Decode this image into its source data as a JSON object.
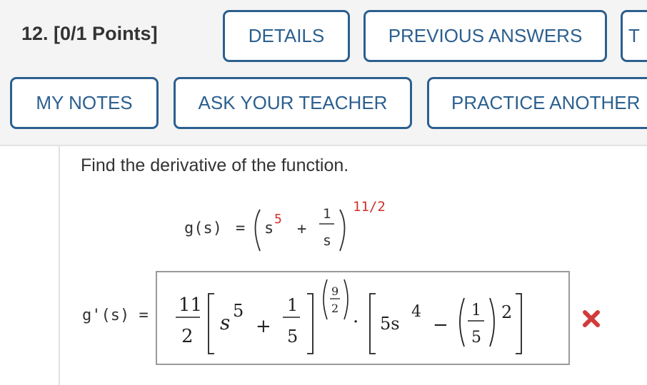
{
  "question": {
    "number_label": "12. [0/1 Points]"
  },
  "toolbar": {
    "details_label": "DETAILS",
    "previous_answers_label": "PREVIOUS ANSWERS",
    "overflow_label": "T",
    "my_notes_label": "MY NOTES",
    "ask_teacher_label": "ASK YOUR TEACHER",
    "practice_another_label": "PRACTICE ANOTHER"
  },
  "problem": {
    "prompt": "Find the derivative of the function.",
    "function_name": "g(s)",
    "equals": "=",
    "base_var": "s",
    "base_exp": "5",
    "plus": "+",
    "frac_num": "1",
    "frac_den": "s",
    "outer_exp": "11/2"
  },
  "answer": {
    "label": "g'(s)",
    "equals": "=",
    "coef_num": "11",
    "coef_den": "2",
    "inner_var": "s",
    "inner_exp": "5",
    "plus": "+",
    "inner_frac_num": "1",
    "inner_frac_den": "5",
    "power_num": "9",
    "power_den": "2",
    "dot": "·",
    "deriv_coef_var": "5s",
    "deriv_exp": "4",
    "minus": "−",
    "deriv_frac_num": "1",
    "deriv_frac_den": "5",
    "deriv_power": "2",
    "status": "incorrect"
  },
  "colors": {
    "button_border": "#2b5f8f",
    "exponent_red": "#d0312d",
    "wrong_red": "#d23a3a"
  },
  "icons": {
    "wrong_mark": "x-mark-icon"
  }
}
